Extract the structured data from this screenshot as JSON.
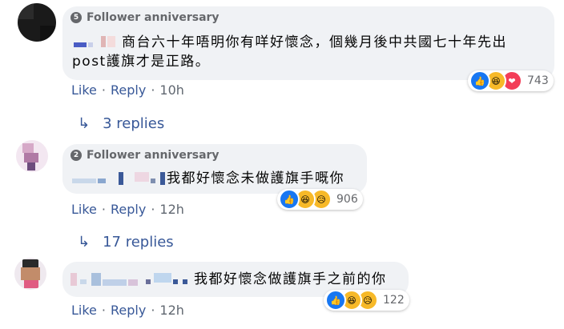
{
  "comments": [
    {
      "badge_number": "5",
      "badge_label": "Follower anniversary",
      "text": "商台六十年唔明你有咩好懷念，個幾月後中共國七十年先出",
      "text_line2": "post護旗才是正路。",
      "like": "Like",
      "reply": "Reply",
      "time": "10h",
      "reaction_count": "743",
      "reactions": [
        "like-icon",
        "haha-icon",
        "love-icon"
      ],
      "replies_label": "3 replies"
    },
    {
      "badge_number": "2",
      "badge_label": "Follower anniversary",
      "text": "我都好懷念未做護旗手嘅你",
      "like": "Like",
      "reply": "Reply",
      "time": "12h",
      "reaction_count": "906",
      "reactions": [
        "like-icon",
        "haha-icon",
        "sad-icon"
      ],
      "replies_label": "17 replies"
    },
    {
      "text": "我都好懷念做護旗手之前的你",
      "like": "Like",
      "reply": "Reply",
      "time": "12h",
      "reaction_count": "122",
      "reactions": [
        "like-icon",
        "haha-icon",
        "sad-icon"
      ]
    }
  ],
  "colors": {
    "link": "#385898",
    "bubble": "#f0f2f5",
    "like": "#1877f2",
    "haha": "#f7b928",
    "love": "#f33e58"
  }
}
